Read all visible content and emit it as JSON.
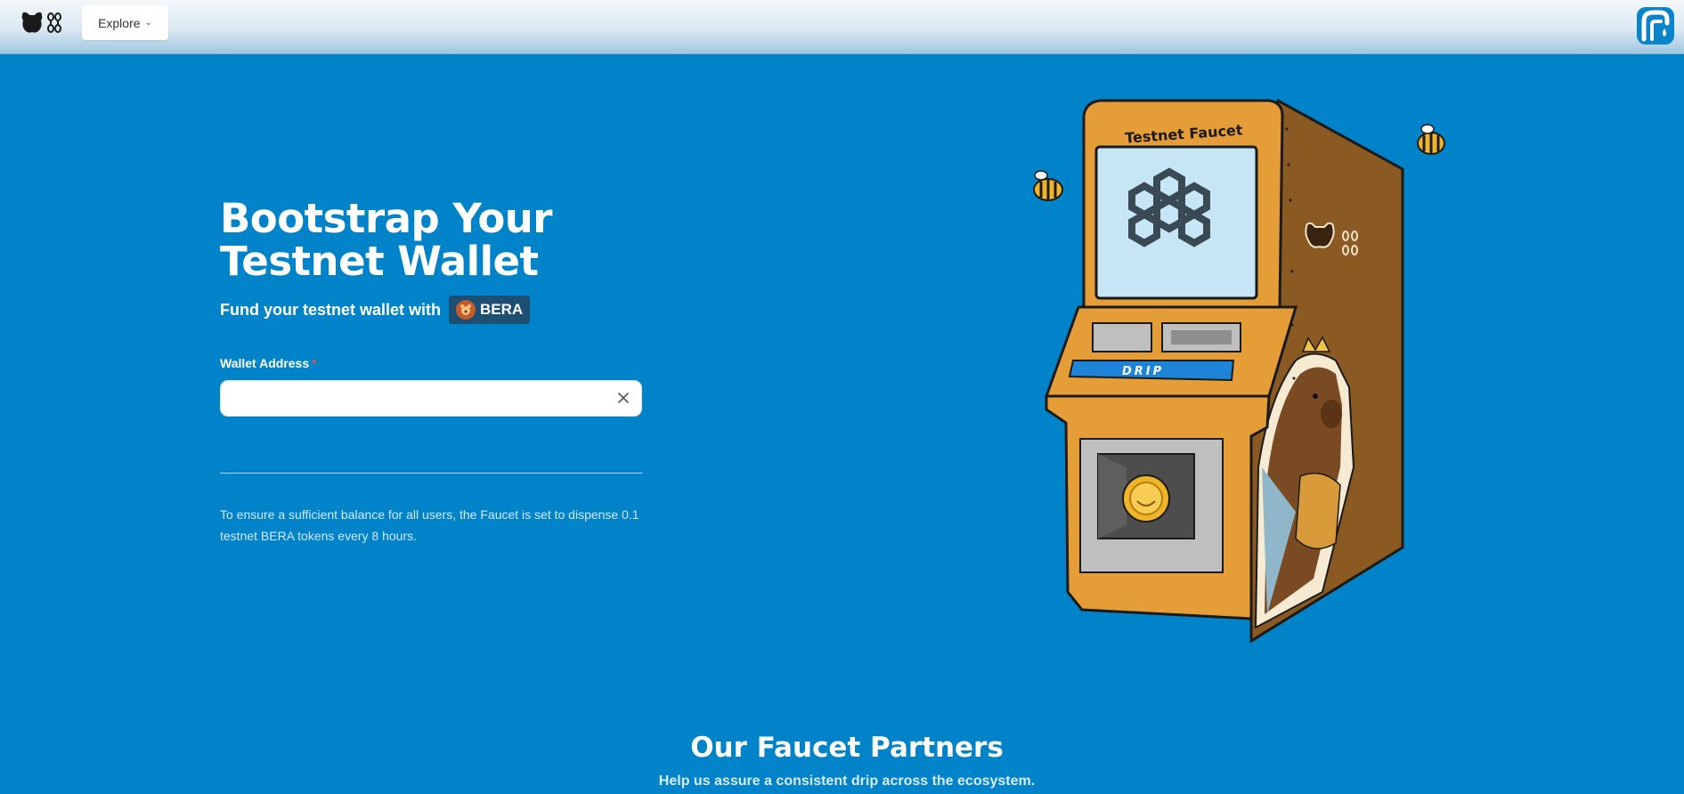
{
  "nav": {
    "explore_label": "Explore",
    "logo_icon": "berachain-logo-icon",
    "faucet_icon": "faucet-logo-icon"
  },
  "hero": {
    "title_line1": "Bootstrap Your",
    "title_line2": "Testnet Wallet",
    "fund_text": "Fund your testnet wallet with",
    "token_label": "BERA"
  },
  "form": {
    "wallet_label": "Wallet Address",
    "required_marker": "*",
    "wallet_value": "",
    "wallet_placeholder": ""
  },
  "note": "To ensure a sufficient balance for all users, the Faucet is set to dispense 0.1 testnet BERA tokens every 8 hours.",
  "illustration": {
    "machine_title": "Testnet Faucet",
    "button_label": "DRIP"
  },
  "partners": {
    "title": "Our Faucet Partners",
    "subtitle": "Help us assure a consistent drip across the ecosystem."
  },
  "colors": {
    "background": "#0083c8",
    "machine": "#e59e37",
    "machine_side": "#8a5a22",
    "screen": "#c6e6f5"
  }
}
